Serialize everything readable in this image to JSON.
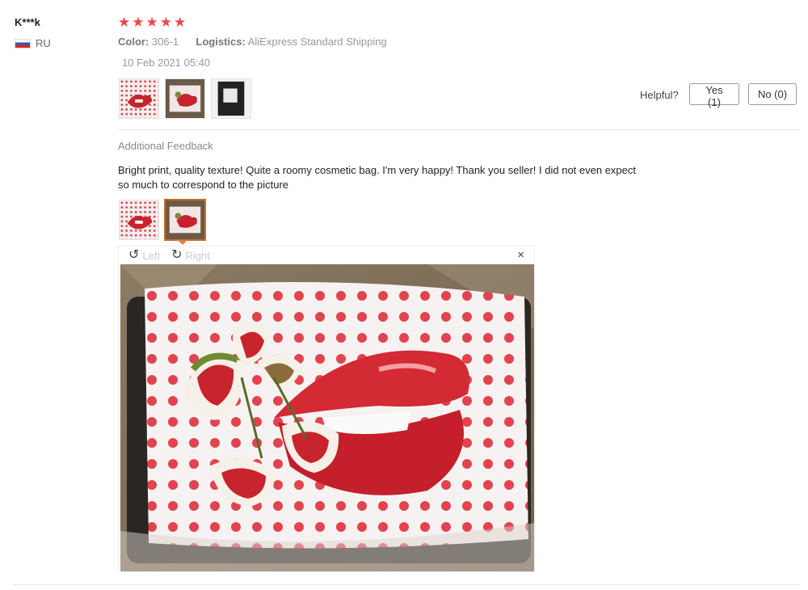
{
  "reviewer": {
    "name": "K***k",
    "country": "RU",
    "flag_icon": "russia-flag-icon"
  },
  "rating": {
    "stars": 5,
    "max": 5,
    "color": "#f04645"
  },
  "meta": {
    "color_label": "Color:",
    "color_value": "306-1",
    "logistics_label": "Logistics:",
    "logistics_value": "AliExpress Standard Shipping",
    "date": "10 Feb 2021 05:40"
  },
  "helpful": {
    "label": "Helpful?",
    "yes": "Yes (1)",
    "no": "No (0)"
  },
  "additional_feedback": {
    "title": "Additional Feedback",
    "text_line1": "Bright print, quality texture! Quite a roomy cosmetic bag. I'm very happy! Thank you seller! I did not even expect",
    "text_line2": "so much to correspond to the picture"
  },
  "viewer": {
    "rotate_left": "Left",
    "rotate_right": "Right",
    "close_symbol": "×",
    "rotate_left_icon": "↺",
    "rotate_right_icon": "↻"
  },
  "colors": {
    "accent": "#c86b2d",
    "star": "#f04645"
  }
}
